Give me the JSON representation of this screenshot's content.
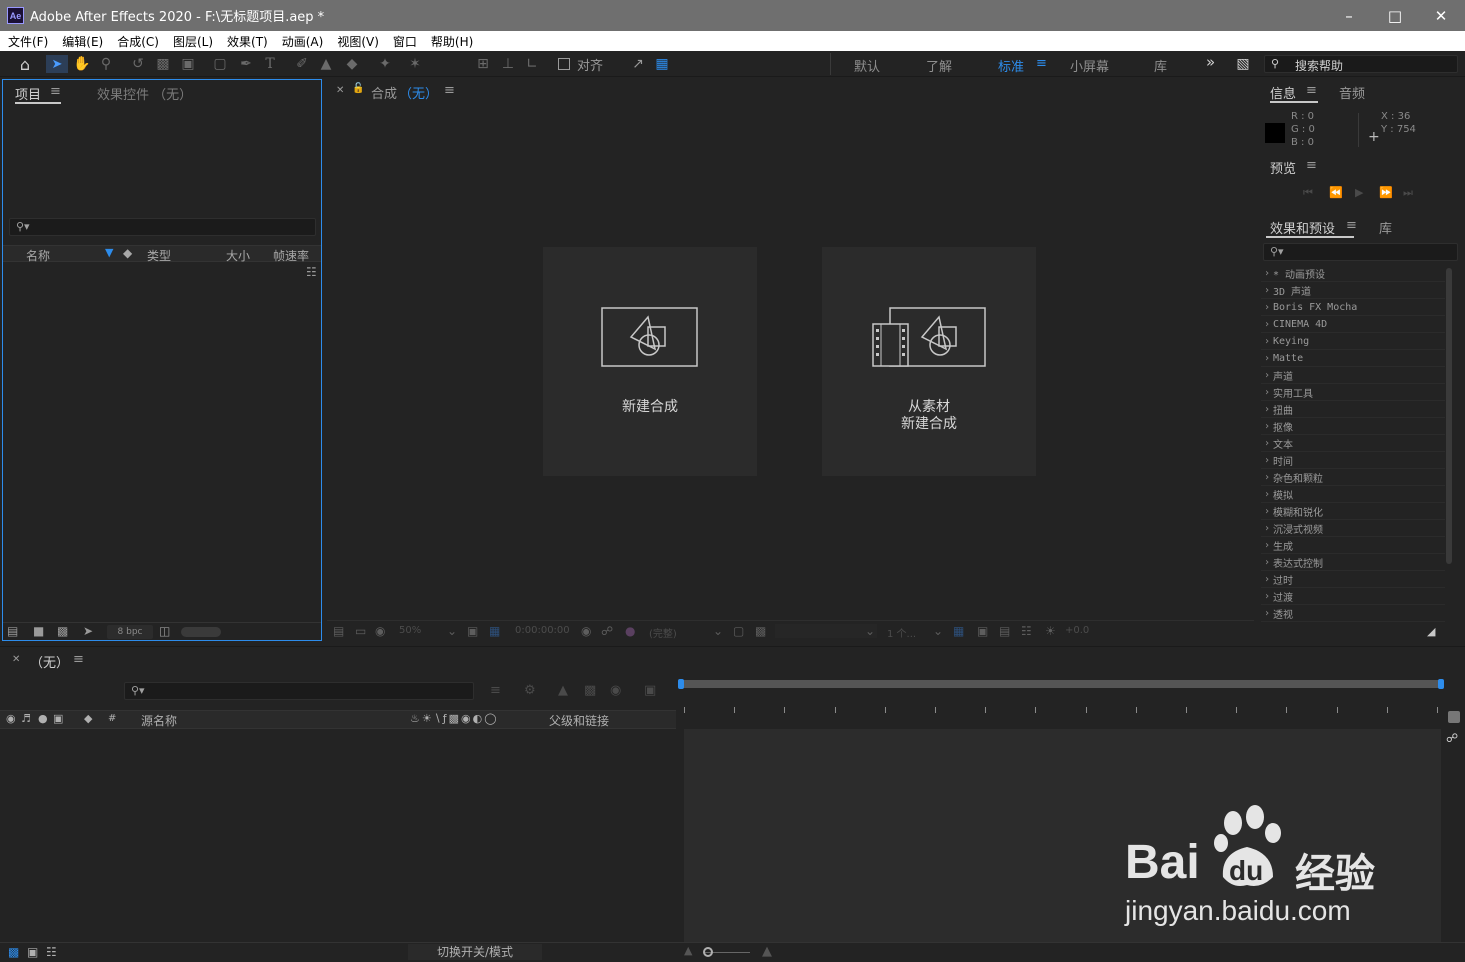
{
  "titlebar": {
    "logo": "Ae",
    "title": "Adobe After Effects 2020 - F:\\无标题项目.aep *",
    "min_icon": "minimize-icon",
    "max_icon": "maximize-icon",
    "close_icon": "close-icon"
  },
  "menu": [
    "文件(F)",
    "编辑(E)",
    "合成(C)",
    "图层(L)",
    "效果(T)",
    "动画(A)",
    "视图(V)",
    "窗口",
    "帮助(H)"
  ],
  "toolbar": {
    "align_label": "对齐",
    "workspaces": [
      "默认",
      "了解",
      "标准",
      "小屏幕",
      "库"
    ],
    "active_workspace": "标准",
    "more": "»",
    "search_help": "搜索帮助"
  },
  "project_panel": {
    "tab_project": "项目",
    "tab_effect_controls": "效果控件 （无）",
    "columns": {
      "name": "名称",
      "type": "类型",
      "size": "大小",
      "fps": "帧速率"
    },
    "bpc": "8 bpc"
  },
  "composition_panel": {
    "tab_label": "合成",
    "tab_value": "（无）",
    "new_comp_label": "新建合成",
    "from_footage_line1": "从素材",
    "from_footage_line2": "新建合成",
    "zoom": "50%",
    "timecode": "0:00:00:00",
    "resolution": "(完整)",
    "view_count": "1 个...",
    "exposure": "+0.0"
  },
  "info_panel": {
    "tab_info": "信息",
    "tab_audio": "音频",
    "r": "R : 0",
    "g": "G : 0",
    "b": "B : 0",
    "x": "X : 36",
    "y": "Y : 754",
    "swatch_color": "#000000"
  },
  "preview_panel": {
    "tab": "预览"
  },
  "effects_panel": {
    "tab": "效果和预设",
    "tab_library": "库",
    "items": [
      "* 动画预设",
      "3D 声道",
      "Boris FX Mocha",
      "CINEMA 4D",
      "Keying",
      "Matte",
      "声道",
      "实用工具",
      "扭曲",
      "抠像",
      "文本",
      "时间",
      "杂色和颗粒",
      "模拟",
      "模糊和锐化",
      "沉浸式视频",
      "生成",
      "表达式控制",
      "过时",
      "过渡",
      "透视"
    ]
  },
  "timeline": {
    "tab": "（无）",
    "col_source": "源名称",
    "col_parent": "父级和链接",
    "col_hash": "#",
    "toggle_label": "切换开关/模式"
  },
  "watermark": {
    "brand": "Bai",
    "brand2": "du",
    "brand3": "经验",
    "url": "jingyan.baidu.com"
  },
  "colors": {
    "accent": "#2d8ceb",
    "panel_bg": "#232323",
    "border_active": "#2d8ceb"
  }
}
